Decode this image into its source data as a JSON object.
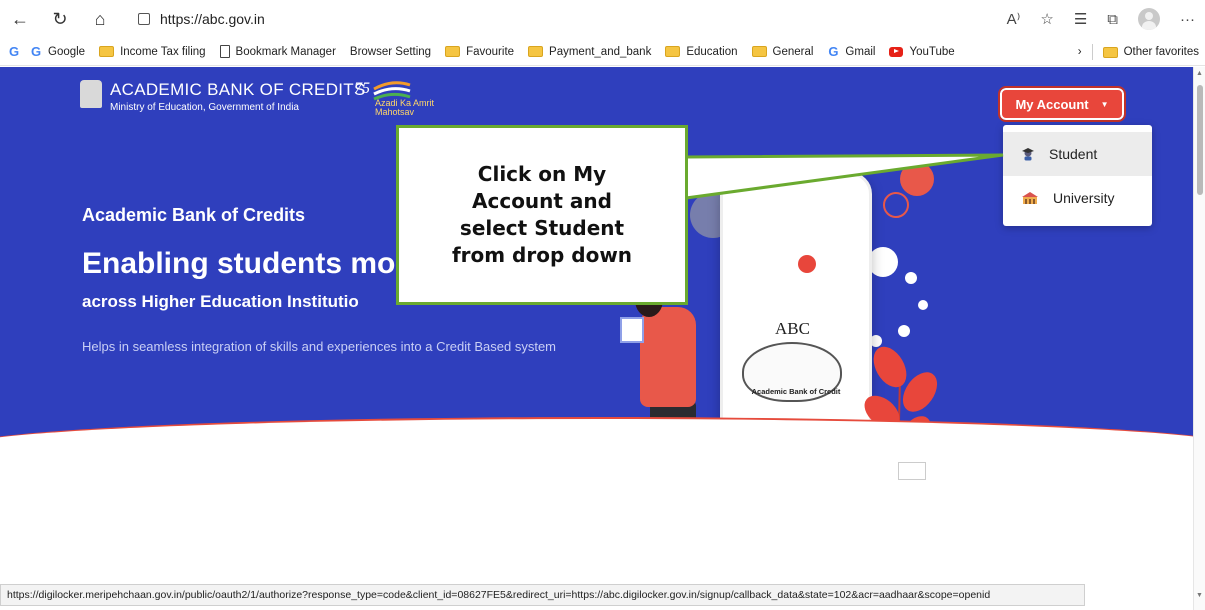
{
  "browser": {
    "url": "https://abc.gov.in",
    "bookmarks": [
      {
        "icon": "google-icon",
        "label": "Google"
      },
      {
        "icon": "folder-icon",
        "label": "Income Tax filing"
      },
      {
        "icon": "document-icon",
        "label": "Bookmark Manager"
      },
      {
        "icon": "none",
        "label": "Browser Setting"
      },
      {
        "icon": "folder-icon",
        "label": "Favourite"
      },
      {
        "icon": "folder-icon",
        "label": "Payment_and_bank"
      },
      {
        "icon": "folder-icon",
        "label": "Education"
      },
      {
        "icon": "folder-icon",
        "label": "General"
      },
      {
        "icon": "google-icon",
        "label": "Gmail"
      },
      {
        "icon": "youtube-icon",
        "label": "YouTube"
      }
    ],
    "other_favorites": "Other favorites",
    "status_url": "https://digilocker.meripehchaan.gov.in/public/oauth2/1/authorize?response_type=code&client_id=08627FE5&redirect_uri=https://abc.digilocker.gov.in/signup/callback_data&state=102&acr=aadhaar&scope=openid"
  },
  "site": {
    "logo_title": "ACADEMIC BANK OF CREDITS",
    "logo_subtitle": "Ministry of Education, Government of India",
    "azadi_text": "Azadi Ka Amrit Mahotsav",
    "heading_small": "Academic Bank of Credits",
    "heading_big": "Enabling students mob",
    "heading_sub": "across Higher Education Institutio",
    "description": "Helps in seamless integration of skills and experiences into a Credit Based system",
    "my_account_label": "My Account",
    "menu": [
      {
        "label": "Student",
        "icon": "student-icon"
      },
      {
        "label": "University",
        "icon": "university-icon"
      }
    ],
    "phone_card_text": "Academic Bank of Credit",
    "piggy_text": "ABC"
  },
  "callout": {
    "text": "Click on My Account and select Student from drop down"
  },
  "colors": {
    "hero_bg": "#2f3fbd",
    "accent_red": "#e8463b",
    "callout_border": "#6aaa2f"
  }
}
